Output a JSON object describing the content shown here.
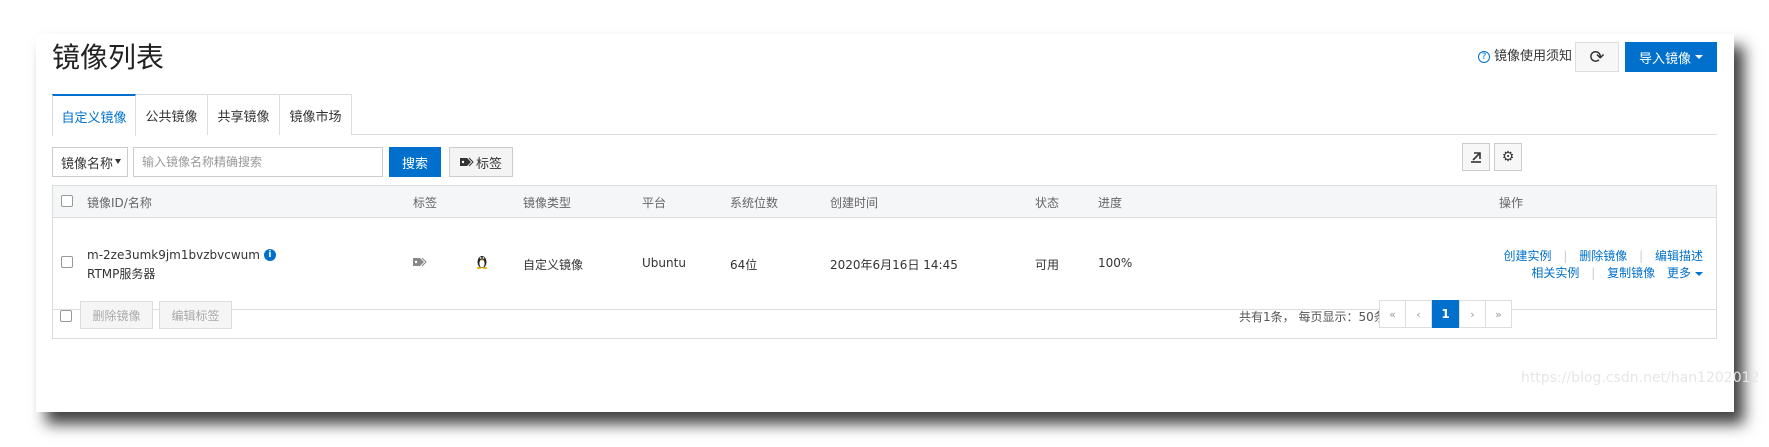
{
  "header": {
    "title": "镜像列表",
    "notice_label": "镜像使用须知",
    "notice_icon": "question-circle-icon",
    "refresh_icon": "refresh-icon",
    "import_label": "导入镜像"
  },
  "tabs": [
    {
      "label": "自定义镜像",
      "active": true
    },
    {
      "label": "公共镜像",
      "active": false
    },
    {
      "label": "共享镜像",
      "active": false
    },
    {
      "label": "镜像市场",
      "active": false
    }
  ],
  "filter": {
    "select_value": "镜像名称",
    "search_placeholder": "输入镜像名称精确搜索",
    "search_label": "搜索",
    "tag_label": "标签"
  },
  "tools": {
    "export_icon": "export-icon",
    "settings_icon": "gear-icon"
  },
  "table": {
    "columns": [
      "镜像ID/名称",
      "标签",
      "镜像类型",
      "平台",
      "系统位数",
      "创建时间",
      "状态",
      "进度",
      "操作"
    ],
    "rows": [
      {
        "id": "m-2ze3umk9jm1bvzbvcwum",
        "name": "RTMP服务器",
        "os_icon": "linux-penguin-icon",
        "type": "自定义镜像",
        "platform": "Ubuntu",
        "bits": "64位",
        "created": "2020年6月16日 14:45",
        "status": "可用",
        "progress": "100%",
        "actions": [
          "创建实例",
          "删除镜像",
          "编辑描述",
          "相关实例",
          "复制镜像",
          "更多"
        ]
      }
    ]
  },
  "footer": {
    "delete_label": "删除镜像",
    "edit_tag_label": "编辑标签",
    "summary": "共有1条， 每页显示：50条",
    "pager": {
      "first": "«",
      "prev": "‹",
      "current": "1",
      "next": "›",
      "last": "»"
    }
  },
  "watermark": "https://blog.csdn.net/han1202012",
  "colors": {
    "accent": "#0070cc"
  }
}
